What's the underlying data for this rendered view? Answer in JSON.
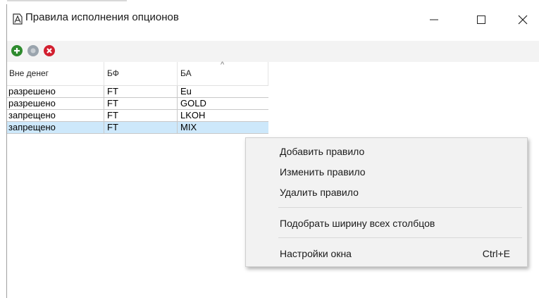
{
  "window": {
    "title": "Правила исполнения опционов",
    "icons": {
      "app": "option-rules-icon",
      "minimize": "minimize-icon",
      "maximize": "maximize-icon",
      "close": "close-icon"
    }
  },
  "toolbar": {
    "buttons": [
      {
        "icon": "add-circle-icon",
        "color": "#2e8b2e",
        "enabled": true
      },
      {
        "icon": "edit-circle-icon",
        "color": "#9aa4ad",
        "enabled": false
      },
      {
        "icon": "delete-circle-icon",
        "color": "#d21f2f",
        "enabled": true
      }
    ]
  },
  "table": {
    "columns": [
      "Вне денег",
      "БФ",
      "БА"
    ],
    "sort_indicator": "^",
    "rows": [
      [
        "разрешено",
        "FT",
        "Eu"
      ],
      [
        "разрешено",
        "FT",
        "GOLD"
      ],
      [
        "запрещено",
        "FT",
        "LKOH"
      ],
      [
        "запрещено",
        "FT",
        "MIX"
      ]
    ],
    "selected_row": 3
  },
  "context_menu": {
    "items": [
      {
        "label": "Добавить правило",
        "shortcut": ""
      },
      {
        "label": "Изменить правило",
        "shortcut": ""
      },
      {
        "label": "Удалить правило",
        "shortcut": ""
      },
      {
        "label": "Подобрать ширину всех столбцов",
        "shortcut": ""
      },
      {
        "label": "Настройки окна",
        "shortcut": "Ctrl+E"
      }
    ]
  },
  "colors": {
    "selection": "#cde8fb",
    "menu_bg": "#f2f2f2",
    "toolbar_bg": "#f3f3f3"
  }
}
